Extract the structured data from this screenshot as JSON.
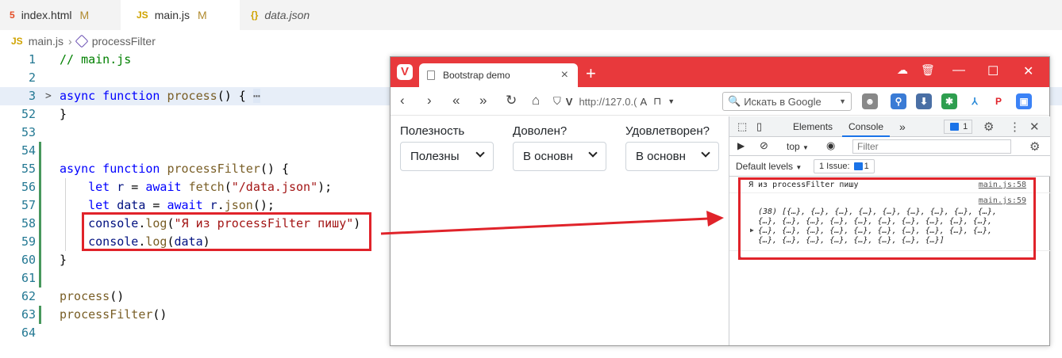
{
  "editor": {
    "tabs": [
      {
        "icon": "5",
        "name": "index.html",
        "status": "M"
      },
      {
        "icon": "JS",
        "name": "main.js",
        "status": "M"
      },
      {
        "icon": "{}",
        "name": "data.json",
        "status": ""
      }
    ],
    "breadcrumb": {
      "file_icon": "JS",
      "file": "main.js",
      "symbol": "processFilter"
    },
    "line_numbers": [
      "1",
      "2",
      "3",
      "52",
      "53",
      "54",
      "55",
      "56",
      "57",
      "58",
      "59",
      "60",
      "61",
      "62",
      "63",
      "64"
    ],
    "lines": {
      "l1": "// main.js",
      "l3_kw": "async function",
      "l3_fn": "process",
      "l3_rest": "() {",
      "l3_fold": "⋯",
      "l52": "}",
      "l55_kw": "async function",
      "l55_fn": "processFilter",
      "l55_rest": "() {",
      "l56_kw": "let",
      "l56_var": "r",
      "l56_eq": " = ",
      "l56_await": "await",
      "l56_fn": "fetch",
      "l56_str": "\"/data.json\"",
      "l56_end": ");",
      "l57_kw": "let",
      "l57_var": "data",
      "l57_eq": " = ",
      "l57_await": "await",
      "l57_obj": "r",
      "l57_fn": "json",
      "l57_end": "();",
      "l58_obj": "console",
      "l58_fn": "log",
      "l58_str": "\"Я из processFilter пишу\"",
      "l59_obj": "console",
      "l59_fn": "log",
      "l59_var": "data",
      "l60": "}",
      "l62_fn": "process",
      "l62_rest": "()",
      "l63_fn": "processFilter",
      "l63_rest": "()"
    }
  },
  "browser": {
    "tab_title": "Bootstrap demo",
    "url": "http://127.0.(",
    "search_placeholder": "Искать в Google",
    "form": [
      {
        "label": "Полезность",
        "value": "Полезны"
      },
      {
        "label": "Доволен?",
        "value": "В основн"
      },
      {
        "label": "Удовлетворен?",
        "value": "В основн"
      }
    ]
  },
  "devtools": {
    "tabs": [
      "Elements",
      "Console"
    ],
    "active_tab": "Console",
    "more": "»",
    "messages_badge": "1",
    "context": "top",
    "filter_placeholder": "Filter",
    "default_levels": "Default levels",
    "issues": "1 Issue:",
    "issues_count": "1",
    "console": {
      "msg1": "Я из processFilter пишу",
      "msg1_link": "main.js:58",
      "msg2_link": "main.js:59",
      "msg2_lines": [
        "(38) [{…}, {…}, {…}, {…}, {…}, {…}, {…}, {…}, {…},",
        "{…}, {…}, {…}, {…}, {…}, {…}, {…}, {…}, {…}, {…},",
        "{…}, {…}, {…}, {…}, {…}, {…}, {…}, {…}, {…}, {…},",
        "{…}, {…}, {…}, {…}, {…}, {…}, {…}, {…}]"
      ],
      "prompt": "›"
    }
  },
  "colors": {
    "highlight": "#e0232a",
    "vivaldi_red": "#e8393c",
    "devtools_blue": "#1a73e8"
  }
}
